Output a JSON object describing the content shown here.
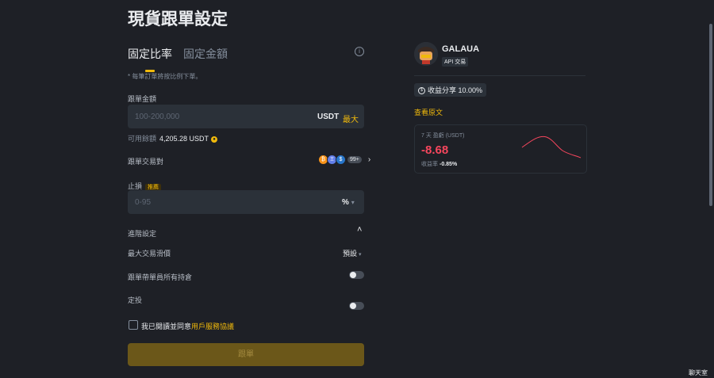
{
  "page": {
    "title": "現貨跟單設定"
  },
  "tabs": [
    {
      "label": "固定比率"
    },
    {
      "label": "固定金額"
    }
  ],
  "note": "* 每筆訂單將按比例下單。",
  "amount": {
    "label": "跟單金額",
    "placeholder": "100-200,000",
    "unit": "USDT",
    "max": "最大"
  },
  "available": {
    "label": "可用餘額",
    "value": "4,205.28 USDT"
  },
  "pairs": {
    "label": "跟單交易對",
    "more": "99+",
    "icons": [
      "btc-icon",
      "eth-icon",
      "usdc-icon"
    ]
  },
  "stoploss": {
    "label": "止損",
    "badge": "推薦",
    "placeholder": "0-95",
    "unit": "%"
  },
  "advanced": {
    "label": "進階設定",
    "slippage_label": "最大交易滑價",
    "slippage_value": "預設",
    "copy_all_label": "跟單帶單員所有持倉",
    "dca_label": "定投"
  },
  "agree": {
    "prefix": "我已閱讀並同意",
    "link": "用戶服務協議"
  },
  "submit": {
    "label": "跟單"
  },
  "trader": {
    "name": "GALAUA",
    "badge": "API 交易",
    "profit_share": "收益分享 10.00%",
    "view_post": "查看原文",
    "stats": {
      "period_label": "7 天 盈虧 (USDT)",
      "pnl": "-8.68",
      "roi_label": "收益率",
      "roi": "-0.85%"
    }
  },
  "chat": {
    "label": "聊天室"
  },
  "colors": {
    "accent": "#f0b90b",
    "negative": "#f6465d",
    "background": "#1e2026",
    "input": "#2b3139"
  }
}
